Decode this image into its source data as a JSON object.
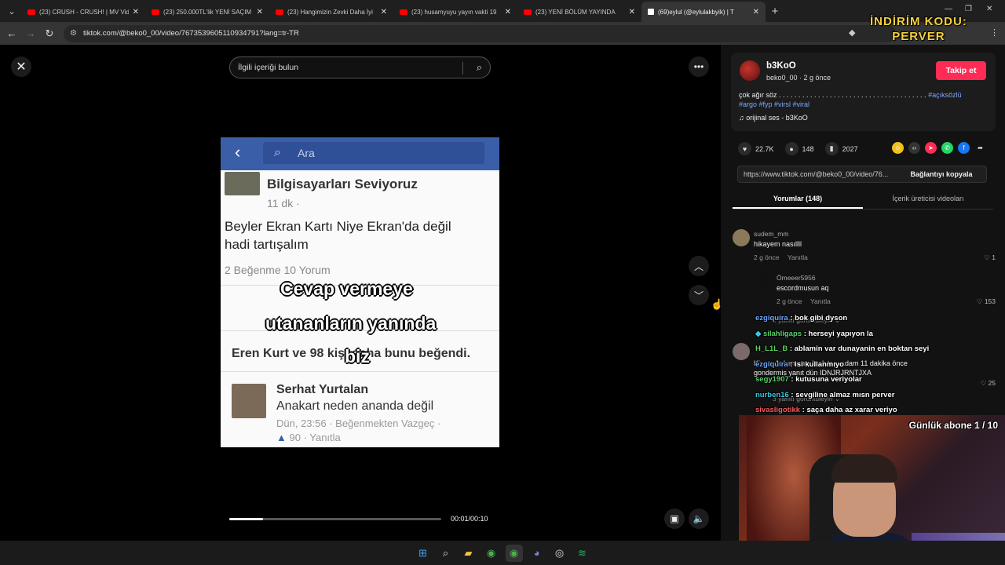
{
  "browser": {
    "tabs": [
      {
        "title": "(23) CRUSH - CRUSH! | MV Vid",
        "icon": "youtube-icon"
      },
      {
        "title": "(23) 250.000TL'lik YENİ SAÇIM",
        "icon": "youtube-icon"
      },
      {
        "title": "(23) Hangimizin Zevki Daha İyi",
        "icon": "youtube-icon"
      },
      {
        "title": "(23) husamyuyu yayın vakti 19",
        "icon": "youtube-icon"
      },
      {
        "title": "(23) YENİ BÖLÜM YAYINDA",
        "icon": "youtube-icon"
      },
      {
        "title": "(69)eylul (@eylulakbyik) | T",
        "icon": "tiktok-icon",
        "active": true
      }
    ],
    "url": "tiktok.com/@beko0_00/video/7673539605110934791?lang=tr-TR"
  },
  "stream_overlay": {
    "promo_line1": "İNDİRİM KODU:",
    "promo_line2": "PERVER",
    "sub_goal": "Günlük abone 1 / 10"
  },
  "video": {
    "search_placeholder": "İlgili içeriği bulun",
    "time": "00:01/00:10",
    "progress_fraction": 0.16,
    "screenshot": {
      "search_text": "Ara",
      "page_name": "Bilgisayarları Seviyoruz",
      "post_age": "11 dk ·",
      "post_text_1": "Beyler Ekran Kartı Niye Ekran'da değil",
      "post_text_2": "hadi tartışalım",
      "post_stats": "2 Beğenme   10 Yorum",
      "likes_line": "Eren Kurt ve 98 kişi daha bunu beğendi.",
      "commenter": "Serhat Yurtalan",
      "comment": "Anakart neden ananda değil",
      "comment_meta": "Dün, 23:56 · Beğenmekten Vazgeç ·",
      "comment_likes": "90 · Yanıtla"
    },
    "captions": [
      "Cevap vermeye",
      "utananların yanında",
      "biz"
    ]
  },
  "author": {
    "name": "b3KoO",
    "handle_time": "beko0_00 · 2 g önce",
    "follow_label": "Takip et",
    "description": "çok ağır söz . . . . . . . . . . . . . . . . . . . . . . . . . . . . . . . . . . . . . .",
    "tags_1": "#açıksözlü",
    "tags_2": "#argo #fyp #virsl #viral",
    "sound": "orijinal ses - b3KoO"
  },
  "stats": {
    "likes": "22.7K",
    "comments": "148",
    "saves": "2027"
  },
  "link": {
    "url": "https://www.tiktok.com/@beko0_00/video/76...",
    "copy_label": "Bağlantıyı kopyala"
  },
  "comment_tabs": {
    "comments": "Yorumlar (148)",
    "creator_videos": "İçerik üreticisi videoları"
  },
  "comments": [
    {
      "user": "sudem_mm",
      "text": "hikayem nasıllll",
      "meta": "2 g önce",
      "reply": "Yanıtla",
      "likes": "1"
    },
    {
      "user": "Ömeeer5956",
      "text": "escordmusun aq",
      "meta": "2 g önce",
      "reply": "Yanıtla",
      "likes": "153"
    },
    {
      "user": "H_L1L_B",
      "text": "Kimse Anlamamış la detayı adam 11 dakika önce gondermiş yanıt dün IDNJRJRNTJXA",
      "likes": "25"
    }
  ],
  "replies_hint": "1 yanıtı görüntüleyin",
  "replies_hint_2": "3 yanıtı görüntüleyin",
  "chat": [
    {
      "user": "ezgiquira",
      "msg": "bok gibi dyson",
      "color": "#6fa8ff"
    },
    {
      "user": "silahligaps",
      "msg": "herseyi yapıyon la",
      "color": "#58d26a"
    },
    {
      "user": "H_L1L_B",
      "msg": "ablamin var dunayanin en boktan seyi",
      "color": "#5ad35a"
    },
    {
      "user": "ezgiquira",
      "msg": "isi kullanmıyo",
      "color": "#6fa8ff"
    },
    {
      "user": "segy1907",
      "msg": "kutusuna veriyolar",
      "color": "#58d26a"
    },
    {
      "user": "nurben16",
      "msg": "sevgiline almaz mısn perver",
      "color": "#3ec7e0"
    },
    {
      "user": "sivasligotikk",
      "msg": "saça daha az xarar veriyo",
      "color": "#ff5a5a"
    }
  ]
}
